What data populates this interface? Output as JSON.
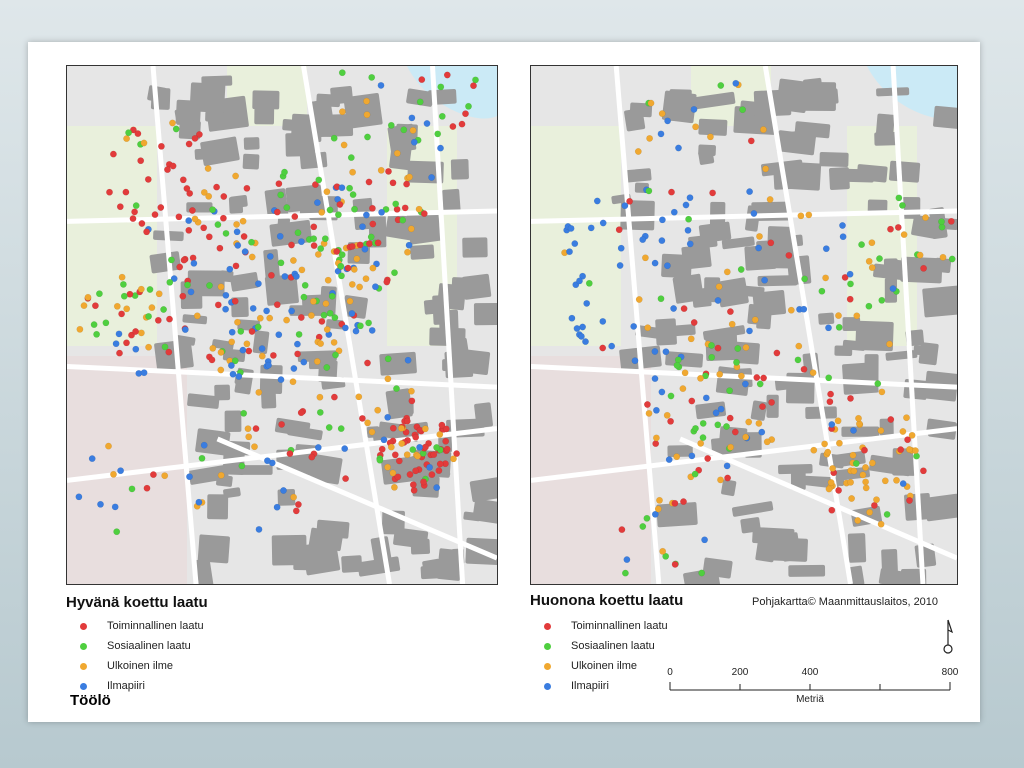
{
  "left_panel": {
    "title": "Hyvänä koettu laatu",
    "place": "Töölö"
  },
  "right_panel": {
    "title": "Huonona koettu laatu",
    "credit": "Pohjakartta© Maanmittauslaitos, 2010"
  },
  "legend": [
    {
      "label": "Toiminnallinen laatu",
      "color": "#e23b3b"
    },
    {
      "label": "Sosiaalinen laatu",
      "color": "#4fcf3f"
    },
    {
      "label": "Ulkoinen ilme",
      "color": "#f0a830"
    },
    {
      "label": "Ilmapiiri",
      "color": "#3a7de0"
    }
  ],
  "scale_bar": {
    "ticks": [
      "0",
      "200",
      "400",
      "800"
    ],
    "unit": "Metriä"
  },
  "colors": {
    "building": "#9a9a9a",
    "park": "#e9f0dc",
    "water": "#cbeaf6",
    "street": "#ffffff",
    "background": "#e6e6e6"
  }
}
